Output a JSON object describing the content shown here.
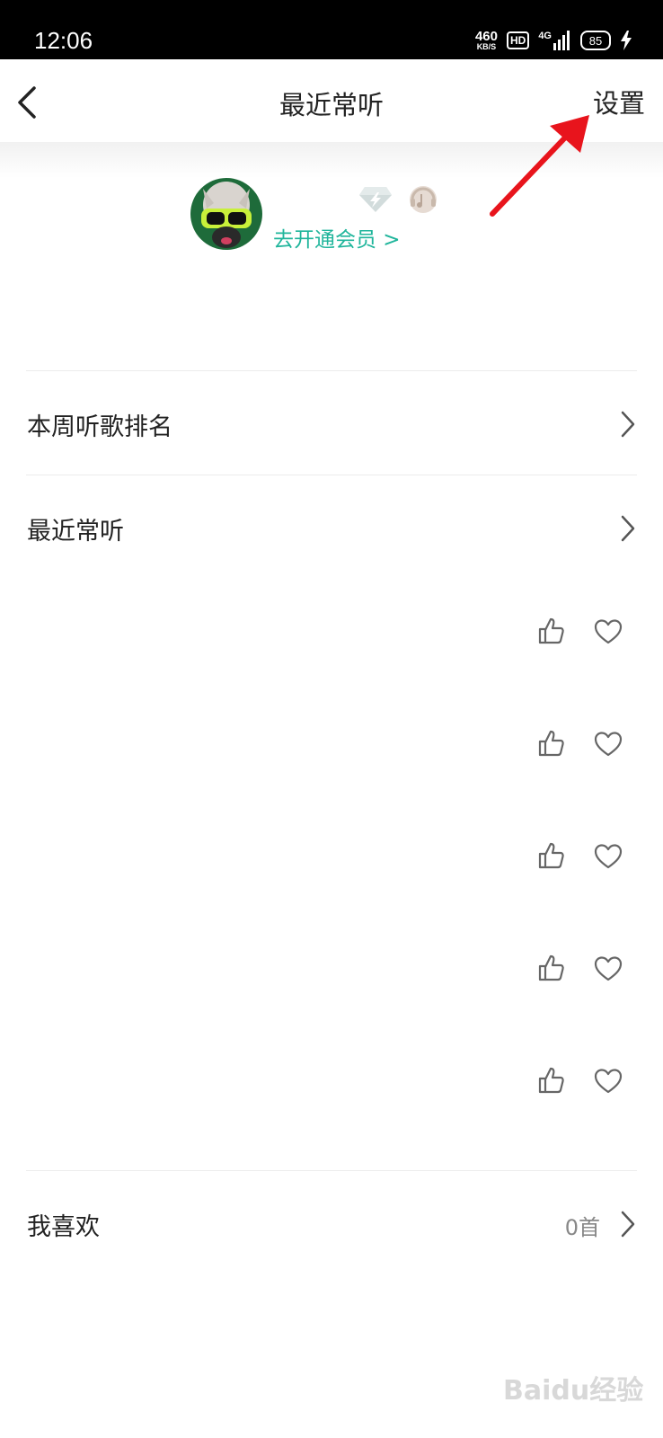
{
  "status_bar": {
    "time": "12:06",
    "net_speed_value": "460",
    "net_speed_unit": "KB/S",
    "hd": "HD",
    "network": "4G",
    "battery": "85"
  },
  "header": {
    "title": "最近常听",
    "settings_label": "设置"
  },
  "profile": {
    "vip_link": "去开通会员 >"
  },
  "sections": {
    "weekly_rank": "本周听歌排名",
    "recent": "最近常听",
    "liked": "我喜欢",
    "liked_count": "0首"
  },
  "watermark": "Baidu经验"
}
